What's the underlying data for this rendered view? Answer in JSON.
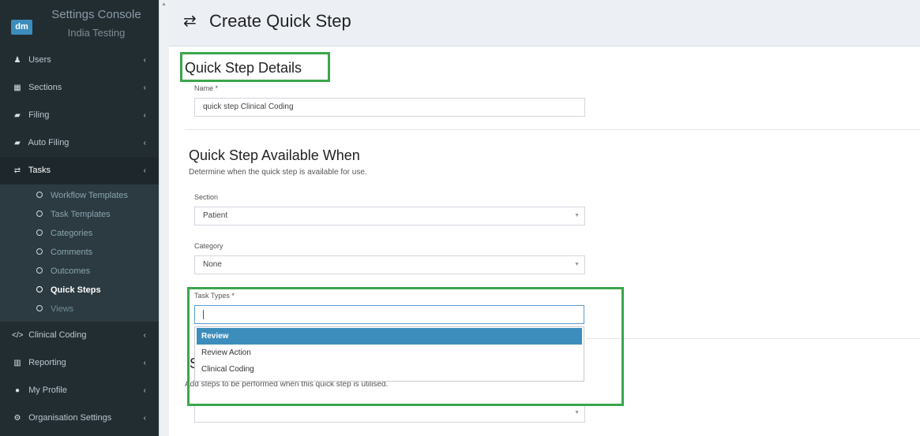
{
  "brand": {
    "logo": "dm",
    "title": "Settings Console",
    "subtitle": "India Testing"
  },
  "sidebar": {
    "items": [
      {
        "label": "Users",
        "icon": "user-icon",
        "glyph": "♟"
      },
      {
        "label": "Sections",
        "icon": "table-icon",
        "glyph": "▦"
      },
      {
        "label": "Filing",
        "icon": "folder-icon",
        "glyph": "▰"
      },
      {
        "label": "Auto Filing",
        "icon": "folder-icon",
        "glyph": "▰"
      },
      {
        "label": "Tasks",
        "icon": "retweet-icon",
        "glyph": "⇄"
      },
      {
        "label": "Clinical Coding",
        "icon": "code-icon",
        "glyph": "</>"
      },
      {
        "label": "Reporting",
        "icon": "bar-chart-icon",
        "glyph": "▥"
      },
      {
        "label": "My Profile",
        "icon": "user-circle-icon",
        "glyph": "●"
      },
      {
        "label": "Organisation Settings",
        "icon": "cogs-icon",
        "glyph": "⚙"
      }
    ],
    "tasks_submenu": [
      "Workflow Templates",
      "Task Templates",
      "Categories",
      "Comments",
      "Outcomes",
      "Quick Steps",
      "Views"
    ],
    "chevron": "‹"
  },
  "header": {
    "icon": "retweet-icon",
    "glyph": "⇄",
    "title": "Create Quick Step"
  },
  "details": {
    "title": "Quick Step Details",
    "name_label": "Name",
    "required_mark": "*",
    "name_value": "quick step Clinical Coding"
  },
  "availability": {
    "title": "Quick Step Available When",
    "help": "Determine when the quick step is available for use.",
    "section_label": "Section",
    "section_value": "Patient",
    "category_label": "Category",
    "category_value": "None",
    "task_types_label": "Task Types",
    "required_mark": "*"
  },
  "dropdown": {
    "options": [
      "Review",
      "Review Action",
      "Clinical Coding"
    ],
    "highlighted": "Review"
  },
  "steps": {
    "title_visible": "S",
    "help_visible": "Add steps to be performed when this quick step is utilised."
  },
  "colors": {
    "sidebar_bg": "#222d32",
    "accent": "#3c8dbc",
    "highlight_box": "#3aa64c"
  }
}
